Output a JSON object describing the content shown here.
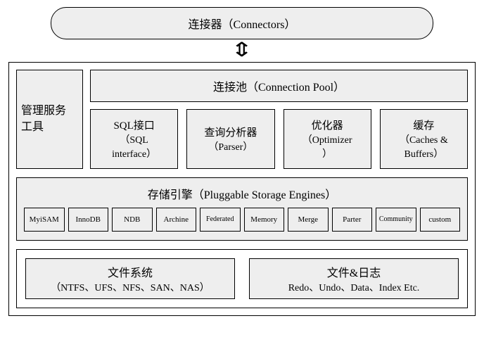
{
  "connectors": "连接器（Connectors）",
  "mgmt": {
    "l1": "管理服务",
    "l2": "工具"
  },
  "pool": "连接池（Connection Pool）",
  "modules": [
    {
      "t": "SQL接口",
      "s1": "（SQL",
      "s2": "interface）"
    },
    {
      "t": "查询分析器",
      "s1": "（Parser）",
      "s2": ""
    },
    {
      "t": "优化器",
      "s1": "（Optimizer",
      "s2": "）"
    },
    {
      "t": "缓存",
      "s1": "（Caches &",
      "s2": "Buffers）"
    }
  ],
  "storage_title": "存储引擎（Pluggable Storage Engines）",
  "engines": [
    "MyiSAM",
    "InnoDB",
    "NDB",
    "Archine",
    "Federated",
    "Memory",
    "Merge",
    "Parter",
    "Community",
    "custom"
  ],
  "fs": {
    "t": "文件系统",
    "s": "（NTFS、UFS、NFS、SAN、NAS）"
  },
  "logs": {
    "t": "文件&日志",
    "s": "Redo、Undo、Data、Index Etc."
  }
}
